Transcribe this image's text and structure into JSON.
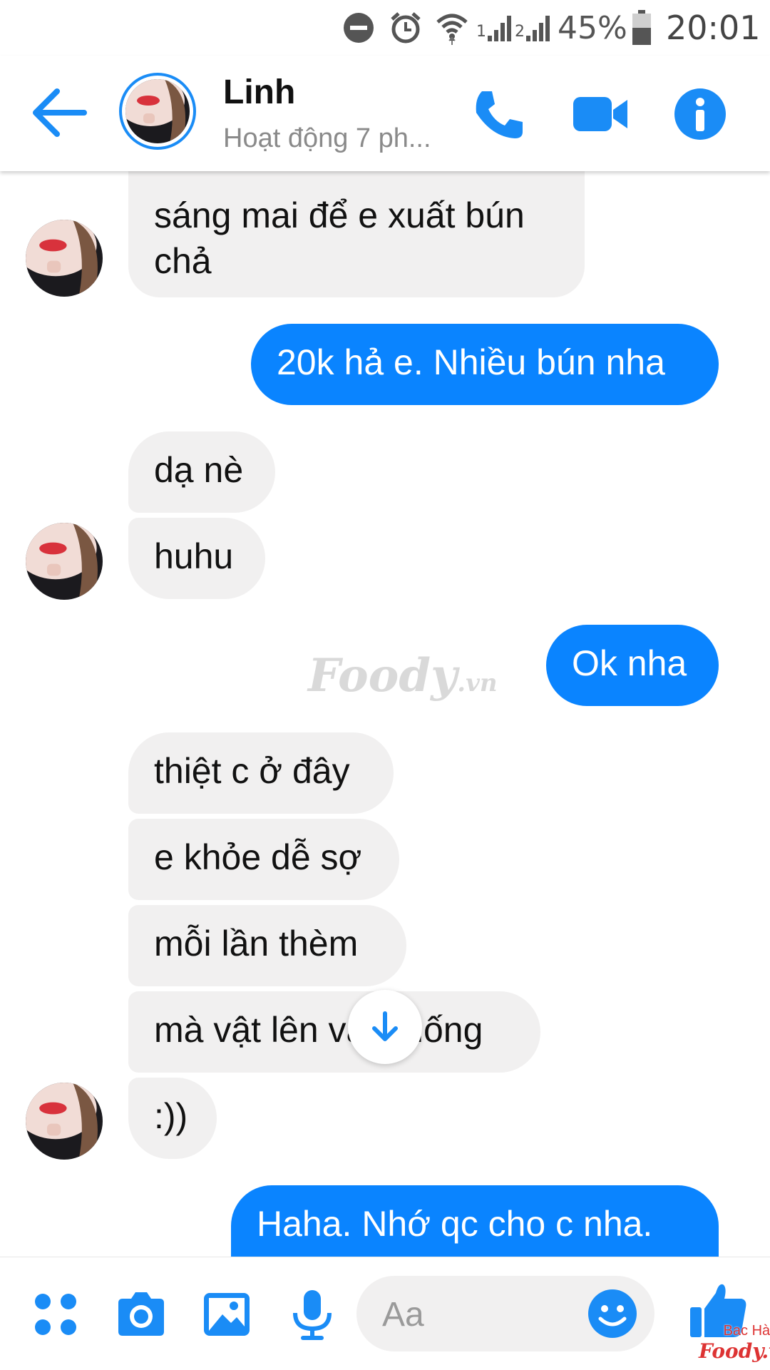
{
  "status_bar": {
    "signal_1": "1",
    "signal_2": "2",
    "battery": "45%",
    "time": "20:01"
  },
  "header": {
    "contact_name": "Linh",
    "contact_status": "Hoạt động 7 ph..."
  },
  "icons": {
    "back": "back-arrow-icon",
    "call": "phone-icon",
    "video": "video-camera-icon",
    "info": "info-icon",
    "apps": "apps-grid-icon",
    "camera": "camera-icon",
    "gallery": "image-icon",
    "mic": "microphone-icon",
    "emoji": "emoji-icon",
    "like": "thumbs-up-icon",
    "scroll_down": "arrow-down-icon"
  },
  "colors": {
    "accent": "#0a84ff",
    "incoming_bubble": "#f1f0f0"
  },
  "messages": [
    {
      "direction": "in",
      "text_lines": [
        "sáng mai để e xuất bún",
        "chả"
      ]
    },
    {
      "direction": "out",
      "text": "20k hả e. Nhiều bún nha"
    },
    {
      "direction": "in",
      "text": "dạ nè"
    },
    {
      "direction": "in",
      "text": "huhu"
    },
    {
      "direction": "out",
      "text": "Ok nha"
    },
    {
      "direction": "in",
      "text": "thiệt c ở đây"
    },
    {
      "direction": "in",
      "text": "e khỏe dễ sợ"
    },
    {
      "direction": "in",
      "text": "mỗi lần thèm"
    },
    {
      "direction": "in",
      "text": "mà vật lên vật xuống"
    },
    {
      "direction": "in",
      "text": ":))"
    },
    {
      "direction": "out",
      "text": "Haha. Nhớ qc cho c nha."
    }
  ],
  "composer": {
    "placeholder": "Aa"
  },
  "watermarks": {
    "center_main": "Foody",
    "center_suffix": ".vn",
    "corner_line1": "Bac Hà",
    "corner_line2": "Foody.vn"
  }
}
